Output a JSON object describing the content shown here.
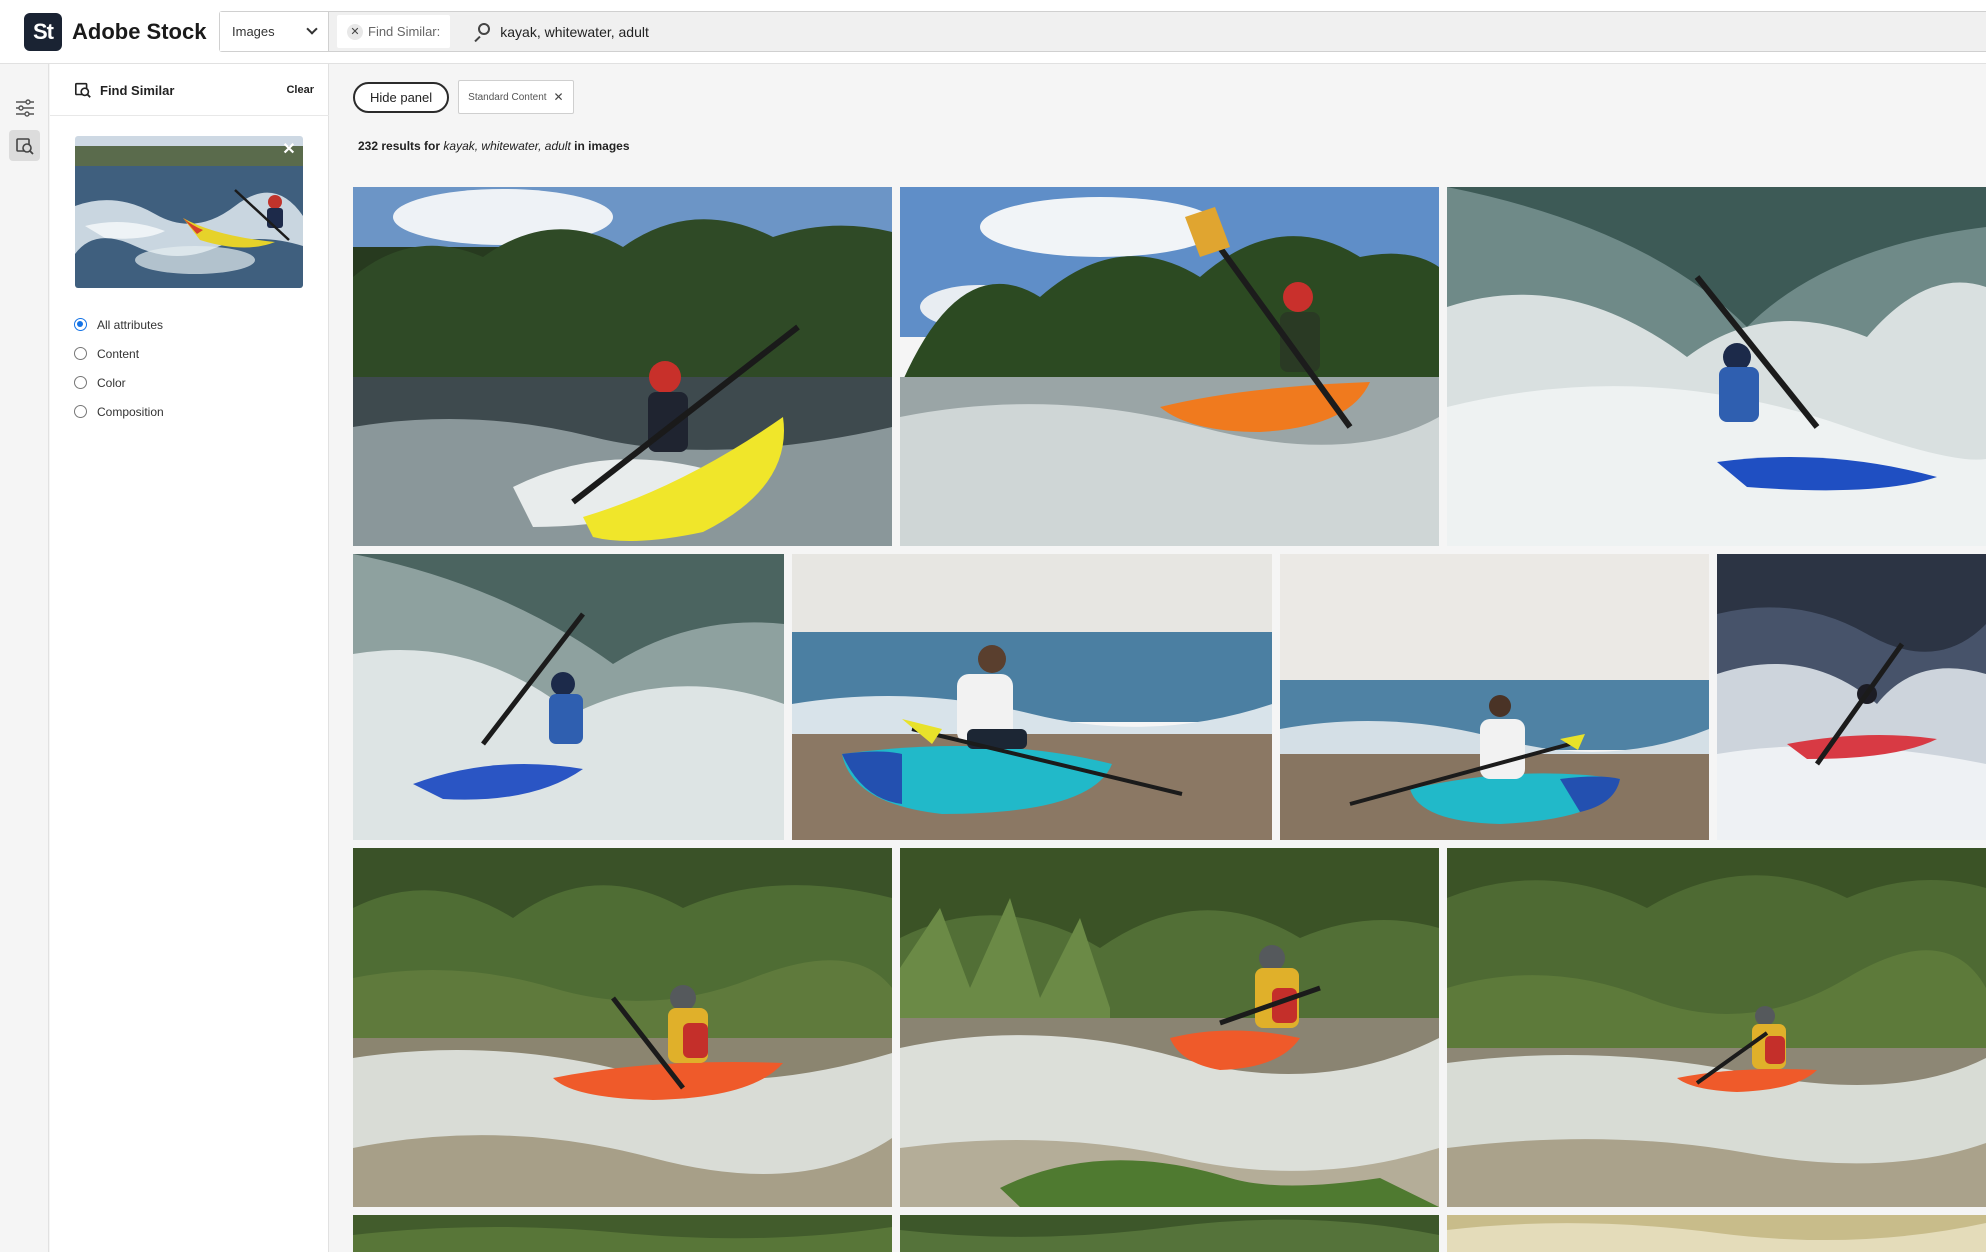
{
  "brand": {
    "badge": "St",
    "name": "Adobe Stock"
  },
  "search": {
    "type_value": "Images",
    "find_similar_label": "Find Similar:",
    "query": "kayak, whitewater, adult"
  },
  "panel": {
    "title": "Find Similar",
    "clear_label": "Clear",
    "options": [
      {
        "label": "All attributes",
        "checked": true
      },
      {
        "label": "Content",
        "checked": false
      },
      {
        "label": "Color",
        "checked": false
      },
      {
        "label": "Composition",
        "checked": false
      }
    ]
  },
  "toolbar": {
    "hide_panel_label": "Hide panel",
    "filter_chip_label": "Standard Content"
  },
  "results": {
    "count": "232",
    "results_for": "results for",
    "terms": "kayak, whitewater, adult",
    "in_label": "in images"
  },
  "icons": {
    "filter": "sliders-icon",
    "find_similar": "find-similar-icon",
    "search": "search-icon",
    "clear_query": "close-icon",
    "dropdown": "chevron-down-icon"
  },
  "colors": {
    "brand_dark": "#1a2333",
    "accent_blue": "#1473e6"
  }
}
